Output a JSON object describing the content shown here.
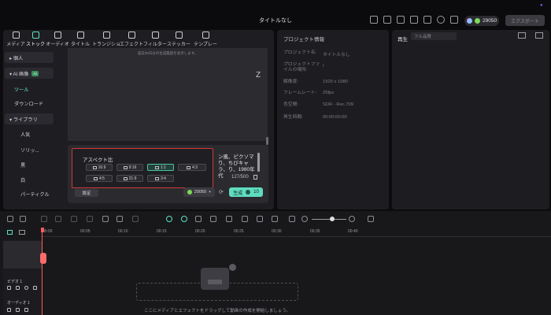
{
  "window": {
    "title": "タイトルなし"
  },
  "header": {
    "credits": "29050",
    "export_label": "エクスポート"
  },
  "media_tabs": [
    {
      "label": "メディア",
      "icon": "media-icon"
    },
    {
      "label": "ストック",
      "icon": "stock-icon",
      "active": true
    },
    {
      "label": "オーディオ",
      "icon": "music-icon"
    },
    {
      "label": "タイトル",
      "icon": "title-icon"
    },
    {
      "label": "トランジション",
      "icon": "transition-icon"
    },
    {
      "label": "エフェクト",
      "icon": "effect-icon"
    },
    {
      "label": "フィルター",
      "icon": "filter-icon"
    },
    {
      "label": "ステッカー",
      "icon": "sticker-icon"
    },
    {
      "label": "テンプレート",
      "icon": "template-icon"
    }
  ],
  "sidebar": {
    "items": [
      {
        "label": "▸ 個人"
      },
      {
        "label": "▾ AI 画像"
      },
      {
        "label": "ツール"
      },
      {
        "label": "ダウンロード"
      },
      {
        "label": "▾ ライブラリ"
      },
      {
        "label": "人気"
      },
      {
        "label": "ソリッ..."
      },
      {
        "label": "黒"
      },
      {
        "label": "白"
      },
      {
        "label": "パーティクル"
      }
    ],
    "ai_badge": "AI"
  },
  "generator": {
    "notice": "過去30日分の生成履歴を表示します。",
    "aspect_title": "アスペクト比",
    "ratios": [
      "16:9",
      "9:16",
      "1:1",
      "4:3",
      "4:5",
      "21:9",
      "3:4"
    ],
    "selected_ratio": "1:1",
    "prompt_text": "ン風、ピクソマり、ちびキャラ、り、1980年代",
    "char_count": "127/500",
    "settings_label": "設定",
    "cost": "29050",
    "generate_label": "生成",
    "generate_cost": "10"
  },
  "properties": {
    "title": "プロジェクト情報",
    "rows": [
      {
        "key": "プロジェクト名:",
        "value": "タイトルなし"
      },
      {
        "key": "プロジェクトファイルの場所:",
        "value": "/"
      },
      {
        "key": "解像度:",
        "value": "1920 x 1080"
      },
      {
        "key": "フレームレート:",
        "value": "25fps"
      },
      {
        "key": "色空間:",
        "value": "SDR - Rec.709"
      },
      {
        "key": "再生時間:",
        "value": "00:00:00:00"
      }
    ]
  },
  "right_panel": {
    "label": "再生",
    "select": "フル品質"
  },
  "timeline": {
    "ticks": [
      "00:00",
      "00:05",
      "00:10",
      "00:15",
      "00:20",
      "00:25",
      "00:30",
      "00:35",
      "00:40"
    ],
    "video_track": "ビデオ 1",
    "audio_track": "オーディオ 1",
    "drop_text": "ここにメディアとエフェクトをドラッグして動画の作成を開始しましょう。"
  }
}
